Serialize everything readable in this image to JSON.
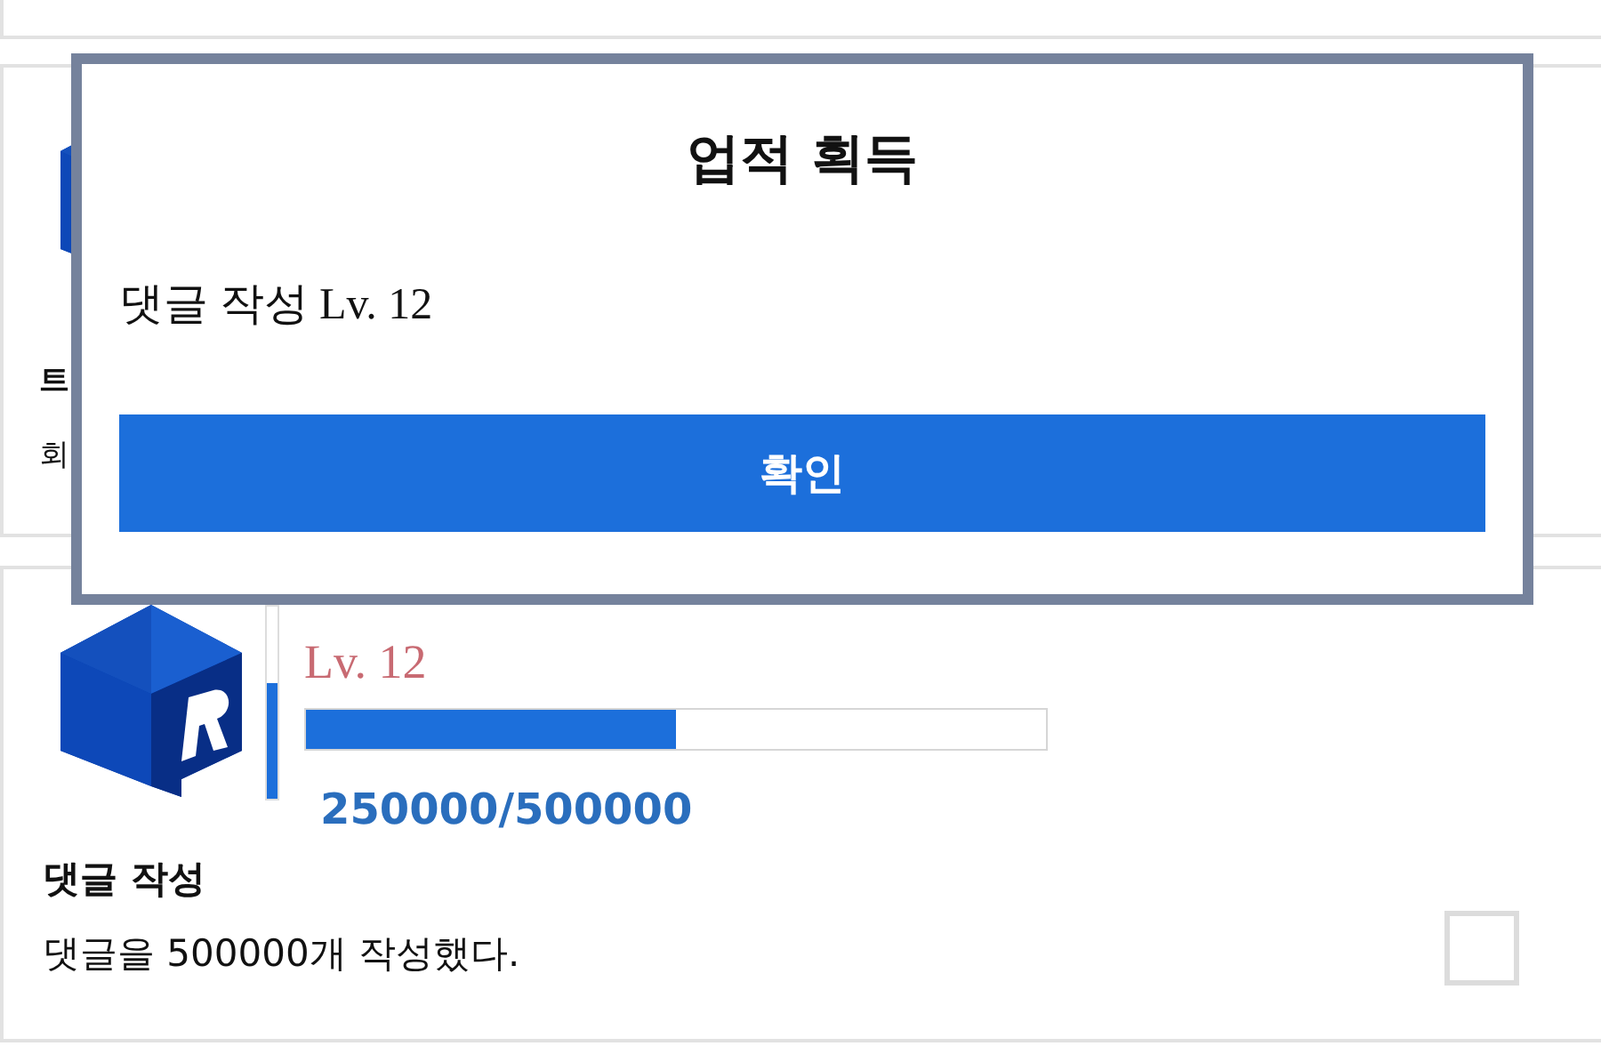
{
  "achievements": [
    {
      "title": "트",
      "description": "회"
    },
    {
      "gauge": {
        "level": 0.6
      },
      "level_label": "Lv. 12",
      "progress": {
        "level": 0.5
      },
      "count": "250000/500000",
      "title": "댓글 작성",
      "description": "댓글을 500000개 작성했다.",
      "checked": false
    }
  ],
  "dialog": {
    "title": "업적 획득",
    "message": "댓글 작성 Lv. 12",
    "confirm_button": "확인"
  }
}
